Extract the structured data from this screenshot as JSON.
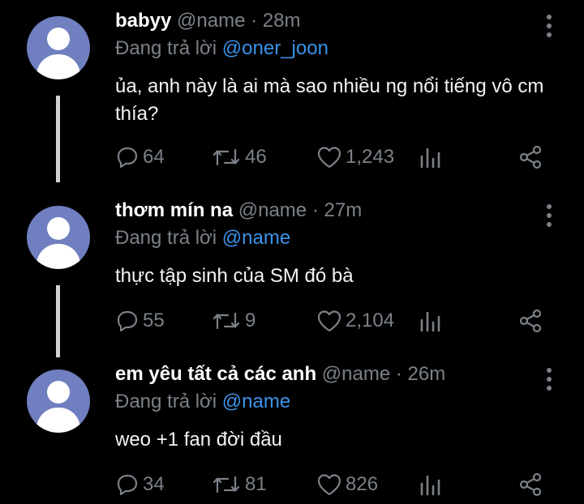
{
  "colors": {
    "background": "#000000",
    "muted": "#7b8188",
    "mention": "#3b93e8",
    "avatar": "#6f7fbf"
  },
  "icons": {
    "reply": "comment-icon",
    "retweet": "retweet-icon",
    "like": "heart-icon",
    "stats": "analytics-icon",
    "share": "share-icon",
    "more": "more-vertical-icon"
  },
  "tweets": [
    {
      "name": "babyy",
      "handle": "@name",
      "separator": "·",
      "time": "28m",
      "reply_prefix": "Đang trả lời",
      "reply_to": "@oner_joon",
      "text": "ủa, anh này là ai mà sao nhiều ng nổi tiếng vô cm thía?",
      "replies": "64",
      "retweets": "46",
      "likes": "1,243"
    },
    {
      "name": "thơm mín na",
      "handle": "@name",
      "separator": "·",
      "time": "27m",
      "reply_prefix": "Đang trả lời",
      "reply_to": "@name",
      "text": "thực tập sinh của SM đó bà",
      "replies": "55",
      "retweets": "9",
      "likes": "2,104"
    },
    {
      "name": "em yêu tất cả các anh",
      "handle": "@name",
      "separator": "·",
      "time": "26m",
      "reply_prefix": "Đang trả lời",
      "reply_to": "@name",
      "text": "weo +1 fan đời đầu",
      "replies": "34",
      "retweets": "81",
      "likes": "826"
    }
  ]
}
